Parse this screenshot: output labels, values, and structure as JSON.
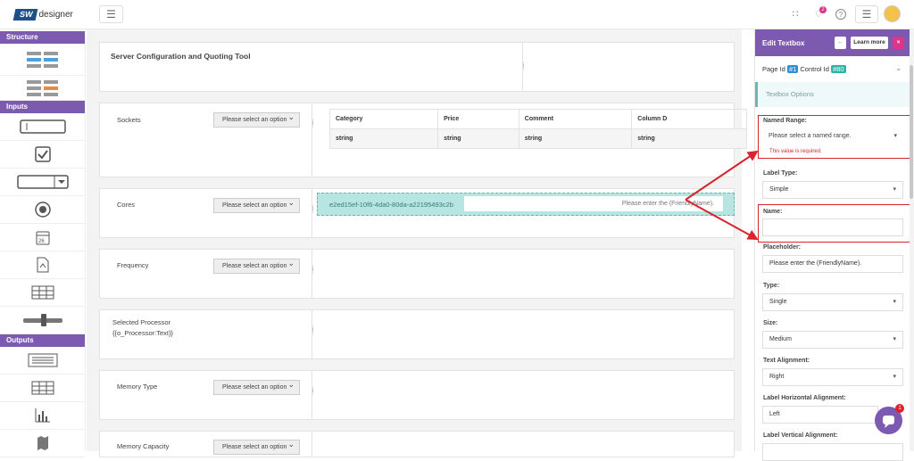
{
  "app": {
    "logo_badge": "SW",
    "logo_text": "designer",
    "notification_count": "2"
  },
  "leftnav": {
    "sections": [
      "Structure",
      "Inputs",
      "Outputs"
    ],
    "icons": [
      "layout-icon",
      "layout-alt-icon",
      "textbox-icon",
      "checkbox-icon",
      "dropdown-icon",
      "radio-icon",
      "date-icon",
      "file-upload-icon",
      "grid-icon",
      "slider-icon",
      "text-output-icon",
      "table-output-icon",
      "chart-icon",
      "map-icon",
      "circle-icon"
    ]
  },
  "canvas": {
    "title": "Server Configuration and Quoting Tool",
    "select_placeholder": "Please select an option",
    "rows": [
      {
        "label": "Sockets"
      },
      {
        "label": "Cores"
      },
      {
        "label": "Frequency"
      },
      {
        "label": "Selected Processor",
        "sublabel": "{{o_Processor:Text}}"
      },
      {
        "label": "Memory Type"
      },
      {
        "label": "Memory Capacity"
      }
    ],
    "grid": {
      "headers": [
        "Category",
        "Price",
        "Comment",
        "Column D"
      ],
      "row": [
        "string",
        "string",
        "string",
        "string"
      ]
    },
    "selected_textbox": {
      "id": "e2ed15ef-10f6-4da0-80da-a22195493c2b",
      "placeholder": "Please enter the (FriendlyName)."
    }
  },
  "panel": {
    "title": "Edit Textbox",
    "learn_more": "Learn more",
    "page_id_label": "Page Id",
    "page_id": "#1",
    "control_id_label": "Control Id",
    "control_id": "#80",
    "tab": "Textbox Options",
    "named_range_label": "Named Range:",
    "named_range_placeholder": "Please select a named range.",
    "named_range_error": "This value is required.",
    "label_type_label": "Label Type:",
    "label_type_value": "Simple",
    "name_label": "Name:",
    "name_value": "",
    "placeholder_label": "Placeholder:",
    "placeholder_value": "Please enter the (FriendlyName).",
    "type_label": "Type:",
    "type_value": "Single",
    "size_label": "Size:",
    "size_value": "Medium",
    "text_align_label": "Text Alignment:",
    "text_align_value": "Right",
    "label_h_align_label": "Label Horizontal Alignment:",
    "label_h_align_value": "Left",
    "label_v_align_label": "Label Vertical Alignment:",
    "chat_badge": "1"
  },
  "colors": {
    "brand": "#7b5ab0",
    "error": "#d9232d",
    "highlight": "#b7e5e1"
  }
}
